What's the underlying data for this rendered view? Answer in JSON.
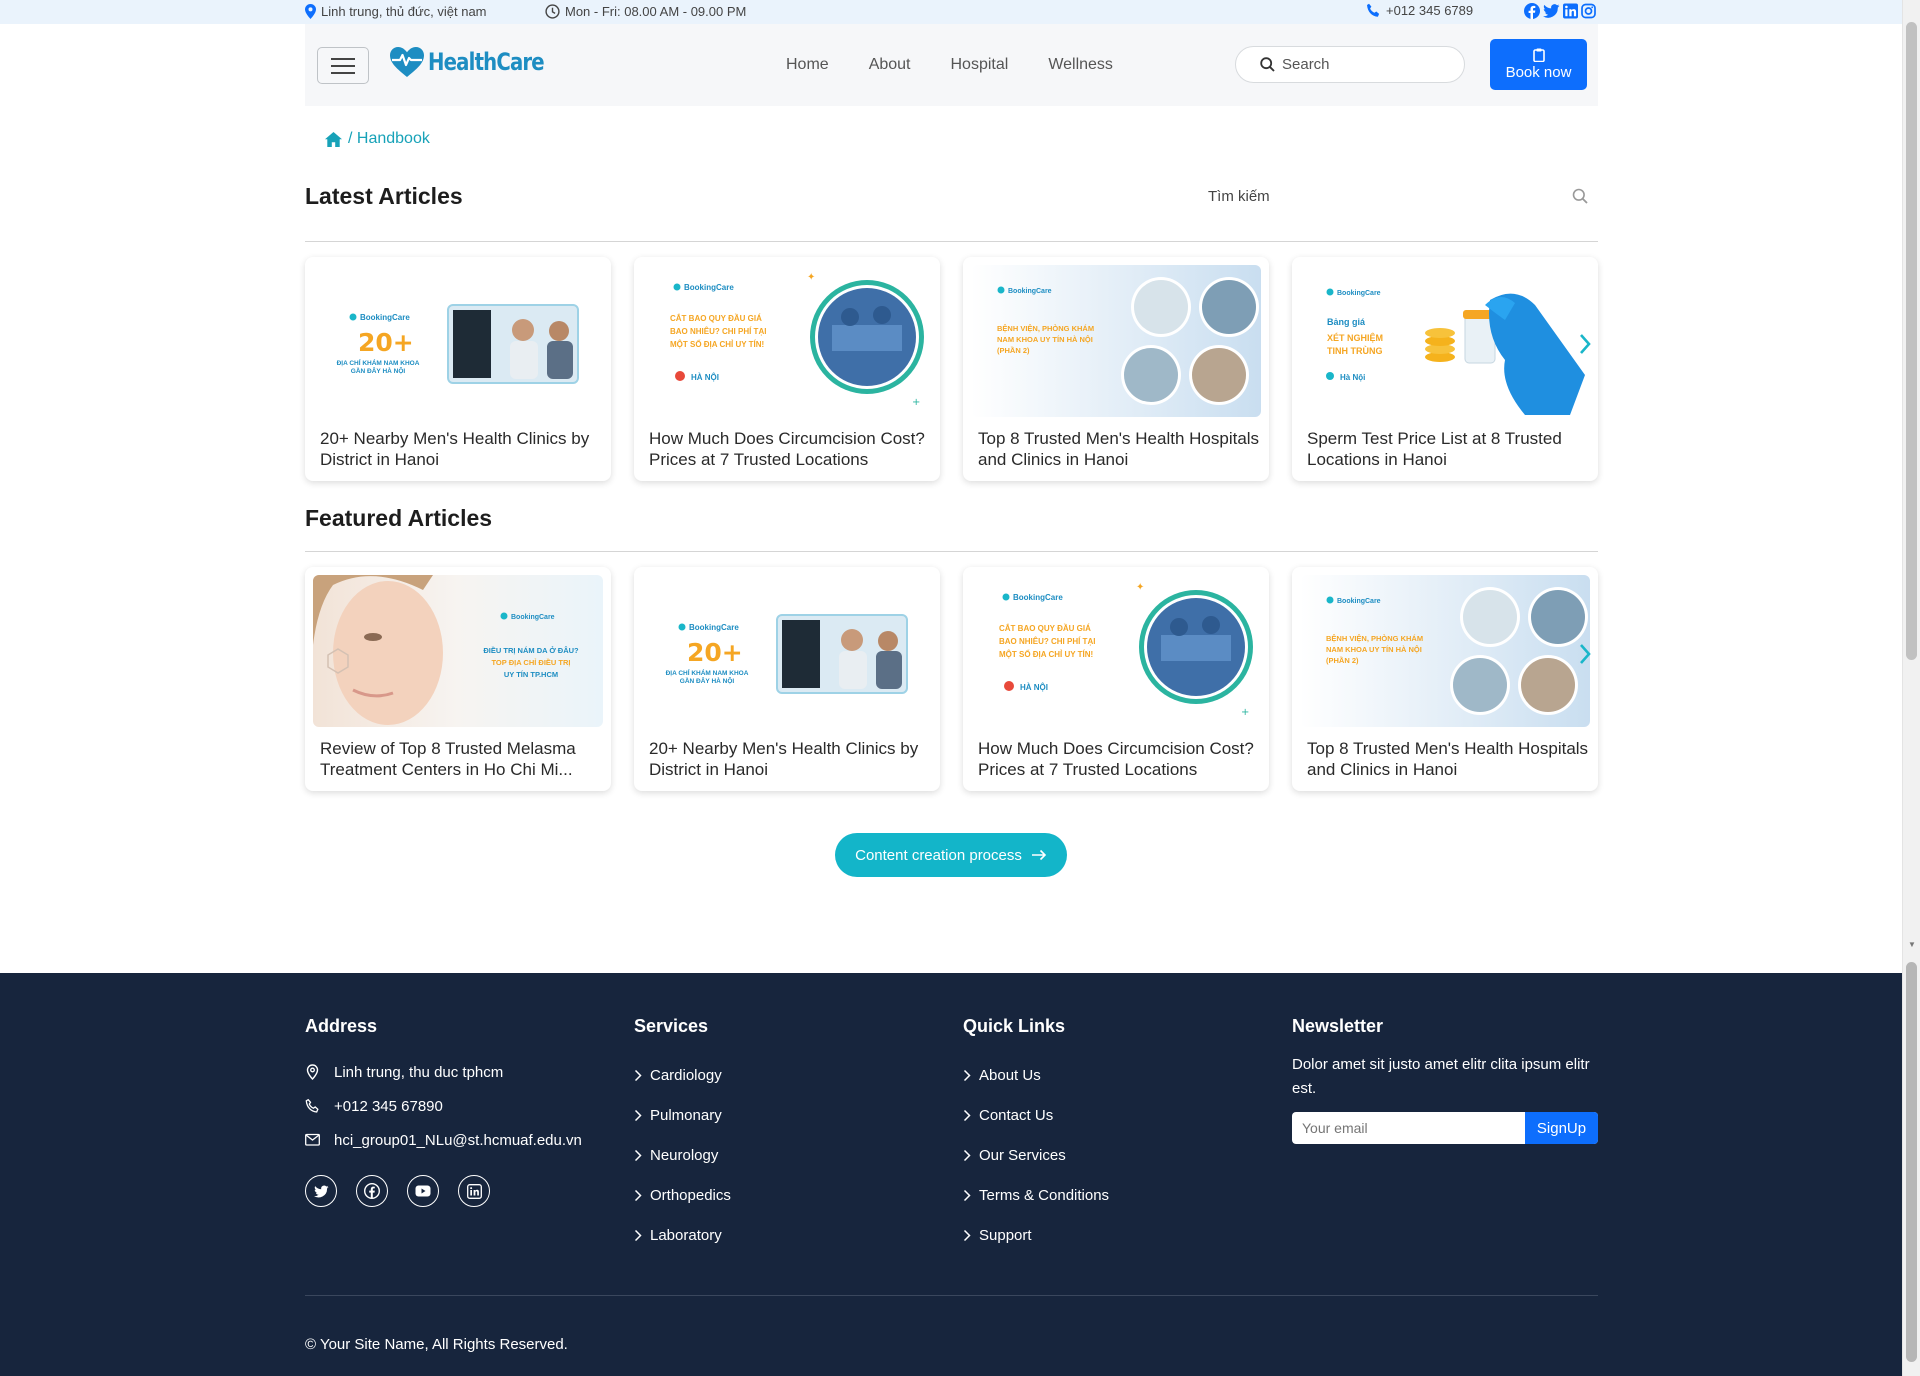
{
  "topbar": {
    "location": "Linh trung, thủ đức, việt nam",
    "hours": "Mon - Fri: 08.00 AM - 09.00 PM",
    "phone": "+012 345 6789",
    "social_icons": [
      "facebook-icon",
      "twitter-icon",
      "linkedin-icon",
      "instagram-icon"
    ]
  },
  "navbar": {
    "brand": "HealthCare",
    "links": [
      "Home",
      "About",
      "Hospital",
      "Wellness"
    ],
    "search_placeholder": "Search",
    "book_label": "Book now"
  },
  "breadcrumb": {
    "current": "/ Handbook"
  },
  "latest": {
    "title": "Latest Articles",
    "search_placeholder": "Tìm kiếm",
    "cards": [
      {
        "title": "20+ Nearby Men's Health Clinics by District in Hanoi",
        "img": {
          "brand": "BookingCare",
          "big": "20+",
          "lines": [
            "ĐỊA CHỈ KHÁM NAM KHOA",
            "GẦN ĐÂY HÀ NỘI"
          ]
        }
      },
      {
        "title": "How Much Does Circumcision Cost? Prices at 7 Trusted Locations",
        "img": {
          "brand": "BookingCare",
          "lines": [
            "CẮT BAO QUY ĐẦU GIÁ",
            "BAO NHIÊU? CHI PHÍ TẠI",
            "MỘT SỐ ĐỊA CHỈ UY TÍN!"
          ],
          "place": "HÀ NỘI"
        }
      },
      {
        "title": "Top 8 Trusted Men's Health Hospitals and Clinics in Hanoi",
        "img": {
          "brand": "BookingCare",
          "lines": [
            "BỆNH VIỆN, PHÒNG KHÁM",
            "NAM KHOA UY TÍN HÀ NỘI",
            "(PHẦN 2)"
          ]
        }
      },
      {
        "title": "Sperm Test Price List at 8 Trusted Locations in Hanoi",
        "img": {
          "brand": "BookingCare",
          "lines": [
            "Bảng giá",
            "XÉT NGHIỆM",
            "TINH TRÙNG"
          ],
          "place": "Hà Nội"
        }
      }
    ]
  },
  "featured": {
    "title": "Featured Articles",
    "cards": [
      {
        "title": "Review of Top 8 Trusted Melasma Treatment Centers in Ho Chi Mi...",
        "img": {
          "brand": "BookingCare",
          "lines": [
            "ĐIỀU TRỊ NÁM DA Ở ĐÂU?",
            "TOP ĐỊA CHỈ ĐIỀU TRỊ",
            "UY TÍN TP.HCM"
          ]
        }
      },
      {
        "title": "20+ Nearby Men's Health Clinics by District in Hanoi",
        "img": {
          "brand": "BookingCare",
          "big": "20+",
          "lines": [
            "ĐỊA CHỈ KHÁM NAM KHOA",
            "GẦN ĐÂY HÀ NỘI"
          ]
        }
      },
      {
        "title": "How Much Does Circumcision Cost? Prices at 7 Trusted Locations",
        "img": {
          "brand": "BookingCare",
          "lines": [
            "CẮT BAO QUY ĐẦU GIÁ",
            "BAO NHIÊU? CHI PHÍ TẠI",
            "MỘT SỐ ĐỊA CHỈ UY TÍN!"
          ],
          "place": "HÀ NỘI"
        }
      },
      {
        "title": "Top 8 Trusted Men's Health Hospitals and Clinics in Hanoi",
        "img": {
          "brand": "BookingCare",
          "lines": [
            "BỆNH VIỆN, PHÒNG KHÁM",
            "NAM KHOA UY TÍN HÀ NỘI",
            "(PHẦN 2)"
          ]
        }
      }
    ]
  },
  "cta": {
    "label": "Content creation process"
  },
  "footer": {
    "address": {
      "title": "Address",
      "location": "Linh trung, thu duc tphcm",
      "phone": "+012 345 67890",
      "email": "hci_group01_NLu@st.hcmuaf.edu.vn",
      "socials": [
        "twitter-icon",
        "facebook-icon",
        "youtube-icon",
        "linkedin-icon"
      ]
    },
    "services": {
      "title": "Services",
      "items": [
        "Cardiology",
        "Pulmonary",
        "Neurology",
        "Orthopedics",
        "Laboratory"
      ]
    },
    "quick_links": {
      "title": "Quick Links",
      "items": [
        "About Us",
        "Contact Us",
        "Our Services",
        "Terms & Conditions",
        "Support"
      ]
    },
    "newsletter": {
      "title": "Newsletter",
      "text": "Dolor amet sit justo amet elitr clita ipsum elitr est.",
      "email_placeholder": "Your email",
      "button": "SignUp"
    },
    "copyright": "© Your Site Name, All Rights Reserved."
  },
  "colors": {
    "accent": "#13b5c9",
    "primary": "#0d6efd",
    "footer_bg": "#17253d",
    "brand": "#1d8dc2",
    "promo_yellow": "#f5a623"
  }
}
